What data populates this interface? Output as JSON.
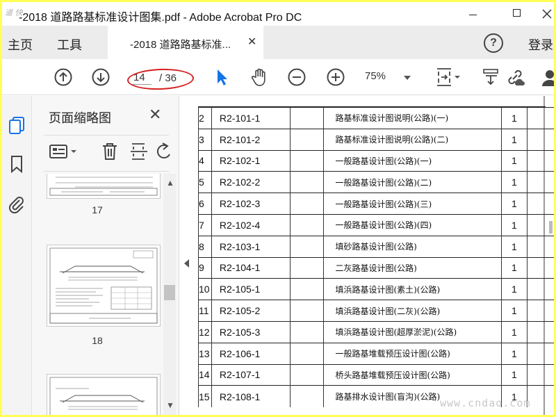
{
  "window": {
    "title": "-2018 道路路基标准设计图集.pdf - Adobe Acrobat Pro DC",
    "app_icon_text": "道 快"
  },
  "tabs": {
    "home": "主页",
    "tools": "工具",
    "document_tab": "-2018 道路路基标准...",
    "login": "登录"
  },
  "toolbar": {
    "current_page": "14",
    "total_pages": "/ 36",
    "zoom": "75%"
  },
  "panel": {
    "title": "页面缩略图",
    "thumbnails": [
      {
        "label": "17"
      },
      {
        "label": "18"
      },
      {
        "label": ""
      }
    ]
  },
  "document": {
    "rows": [
      {
        "no": "2",
        "code": "R2-101-1",
        "name": "路基标准设计图说明(公路)(一)",
        "qty": "1"
      },
      {
        "no": "3",
        "code": "R2-101-2",
        "name": "路基标准设计图说明(公路)(二)",
        "qty": "1"
      },
      {
        "no": "4",
        "code": "R2-102-1",
        "name": "一般路基设计图(公路)(一)",
        "qty": "1"
      },
      {
        "no": "5",
        "code": "R2-102-2",
        "name": "一般路基设计图(公路)(二)",
        "qty": "1"
      },
      {
        "no": "6",
        "code": "R2-102-3",
        "name": "一般路基设计图(公路)(三)",
        "qty": "1"
      },
      {
        "no": "7",
        "code": "R2-102-4",
        "name": "一般路基设计图(公路)(四)",
        "qty": "1"
      },
      {
        "no": "8",
        "code": "R2-103-1",
        "name": "填砂路基设计图(公路)",
        "qty": "1"
      },
      {
        "no": "9",
        "code": "R2-104-1",
        "name": "二灰路基设计图(公路)",
        "qty": "1"
      },
      {
        "no": "10",
        "code": "R2-105-1",
        "name": "填浜路基设计图(素土)(公路)",
        "qty": "1"
      },
      {
        "no": "11",
        "code": "R2-105-2",
        "name": "填浜路基设计图(二灰)(公路)",
        "qty": "1"
      },
      {
        "no": "12",
        "code": "R2-105-3",
        "name": "填浜路基设计图(超厚淤泥)(公路)",
        "qty": "1"
      },
      {
        "no": "13",
        "code": "R2-106-1",
        "name": "一般路基堆载预压设计图(公路)",
        "qty": "1"
      },
      {
        "no": "14",
        "code": "R2-107-1",
        "name": "桥头路基堆载预压设计图(公路)",
        "qty": "1"
      },
      {
        "no": "15",
        "code": "R2-108-1",
        "name": "路基排水设计图(盲沟)(公路)",
        "qty": "1"
      }
    ]
  },
  "watermark": "www.cndao.com",
  "colors": {
    "accent_blue": "#1473e6",
    "annotation_red": "#d61f1f",
    "screenshot_border": "#ffff55"
  }
}
